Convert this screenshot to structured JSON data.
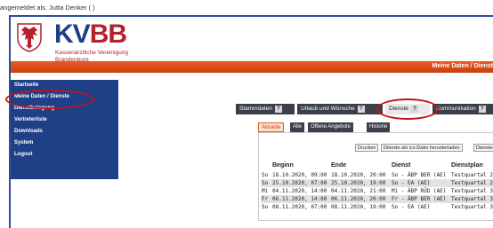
{
  "header": {
    "login_text": "angemeldet als: Jutta Denker ( )",
    "logo_kv": "KV",
    "logo_bb": "BB",
    "logo_sub_line1": "Kassenärztliche Vereinigung",
    "logo_sub_line2": "Brandenburg",
    "page_title": "Meine Daten / Dienst"
  },
  "sidebar": {
    "items": [
      {
        "label": "Startseite"
      },
      {
        "label": "Meine Daten / Dienste"
      },
      {
        "label": "Dienstbelegung"
      },
      {
        "label": "Vertreterliste"
      },
      {
        "label": "Downloads"
      },
      {
        "label": "System"
      },
      {
        "label": "Logout"
      }
    ]
  },
  "tabs": [
    {
      "label": "Stammdaten",
      "help": "?"
    },
    {
      "label": "Urlaub und Wünsche",
      "help": "?"
    },
    {
      "label": "Dienste",
      "help": "?"
    },
    {
      "label": "Kommunikation",
      "help": "?"
    }
  ],
  "subtabs": [
    {
      "label": "Aktuelle"
    },
    {
      "label": "Alle"
    },
    {
      "label": "Offene Angebote"
    },
    {
      "label": "Historie"
    }
  ],
  "buttons": {
    "print": "Drucken",
    "ics": "Dienste als ics-Datei herunterladen",
    "more": "Dienste für"
  },
  "table": {
    "headers": [
      "Beginn",
      "Ende",
      "Dienst",
      "Dienstplan"
    ],
    "rows": [
      {
        "day": "So",
        "begin": "18.10.2020, 09:00",
        "end": "18.10.2020, 20:00",
        "service": "So - ÄBP BER (AE)",
        "plan": "Testquartal 2"
      },
      {
        "day": "So",
        "begin": "25.10.2020, 07:00",
        "end": "25.10.2020, 19:00",
        "service": "So - EA (AE)",
        "plan": "Testquartal 2"
      },
      {
        "day": "Mi",
        "begin": "04.11.2020, 14:00",
        "end": "04.11.2020, 21:00",
        "service": "Mi - ÄBP RÜD (AE)",
        "plan": "Testquartal 3"
      },
      {
        "day": "Fr",
        "begin": "06.11.2020, 14:00",
        "end": "06.11.2020, 20:00",
        "service": "Fr - ÄBP BER (AE)",
        "plan": "Testquartal 3"
      },
      {
        "day": "So",
        "begin": "08.11.2020, 07:00",
        "end": "08.11.2020, 19:00",
        "service": "So - EA (AE)",
        "plan": "Testquartal 3"
      }
    ]
  },
  "colors": {
    "brand_blue": "#1f3f86",
    "brand_red": "#b4222c",
    "orange_bar": "#e85a1f",
    "highlight_oval": "#c0141d"
  },
  "icons": {
    "crest": "brandenburg-eagle-crest",
    "help": "question-mark-icon",
    "tab_arrow": "tab-arrow-icon"
  }
}
